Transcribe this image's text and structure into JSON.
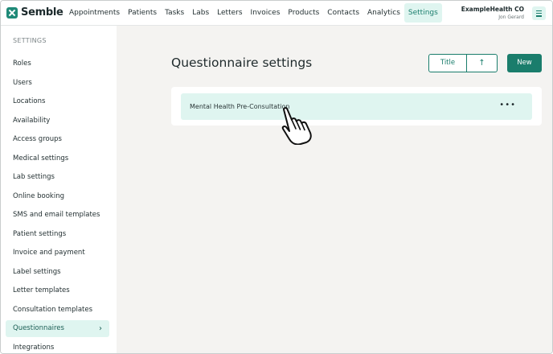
{
  "app": {
    "logo_text": "Semble",
    "brand_color": "#1a7d6c",
    "accent_bg": "#dff5f0"
  },
  "nav": {
    "items": [
      "Appointments",
      "Patients",
      "Tasks",
      "Labs",
      "Letters",
      "Invoices",
      "Products",
      "Contacts",
      "Analytics",
      "Settings"
    ],
    "active": "Settings"
  },
  "account": {
    "org_name": "ExampleHealth CO",
    "user_name": "Jon Gerard",
    "menu_icon": "hamburger-icon"
  },
  "sidebar": {
    "title": "SETTINGS",
    "items": [
      {
        "label": "Roles"
      },
      {
        "label": "Users"
      },
      {
        "label": "Locations"
      },
      {
        "label": "Availability"
      },
      {
        "label": "Access groups"
      },
      {
        "label": "Medical settings"
      },
      {
        "label": "Lab settings"
      },
      {
        "label": "Online booking"
      },
      {
        "label": "SMS and email templates"
      },
      {
        "label": "Patient settings"
      },
      {
        "label": "Invoice and payment"
      },
      {
        "label": "Label settings"
      },
      {
        "label": "Letter templates"
      },
      {
        "label": "Consultation templates"
      },
      {
        "label": "Questionnaires",
        "active": true
      },
      {
        "label": "Integrations"
      }
    ],
    "active_chevron": "›"
  },
  "main": {
    "title": "Questionnaire settings",
    "sort": {
      "field_label": "Title",
      "direction_icon": "↑"
    },
    "new_label": "New",
    "questionnaires": [
      {
        "name": "Mental Health Pre-Consultation",
        "more": "•••"
      }
    ]
  }
}
